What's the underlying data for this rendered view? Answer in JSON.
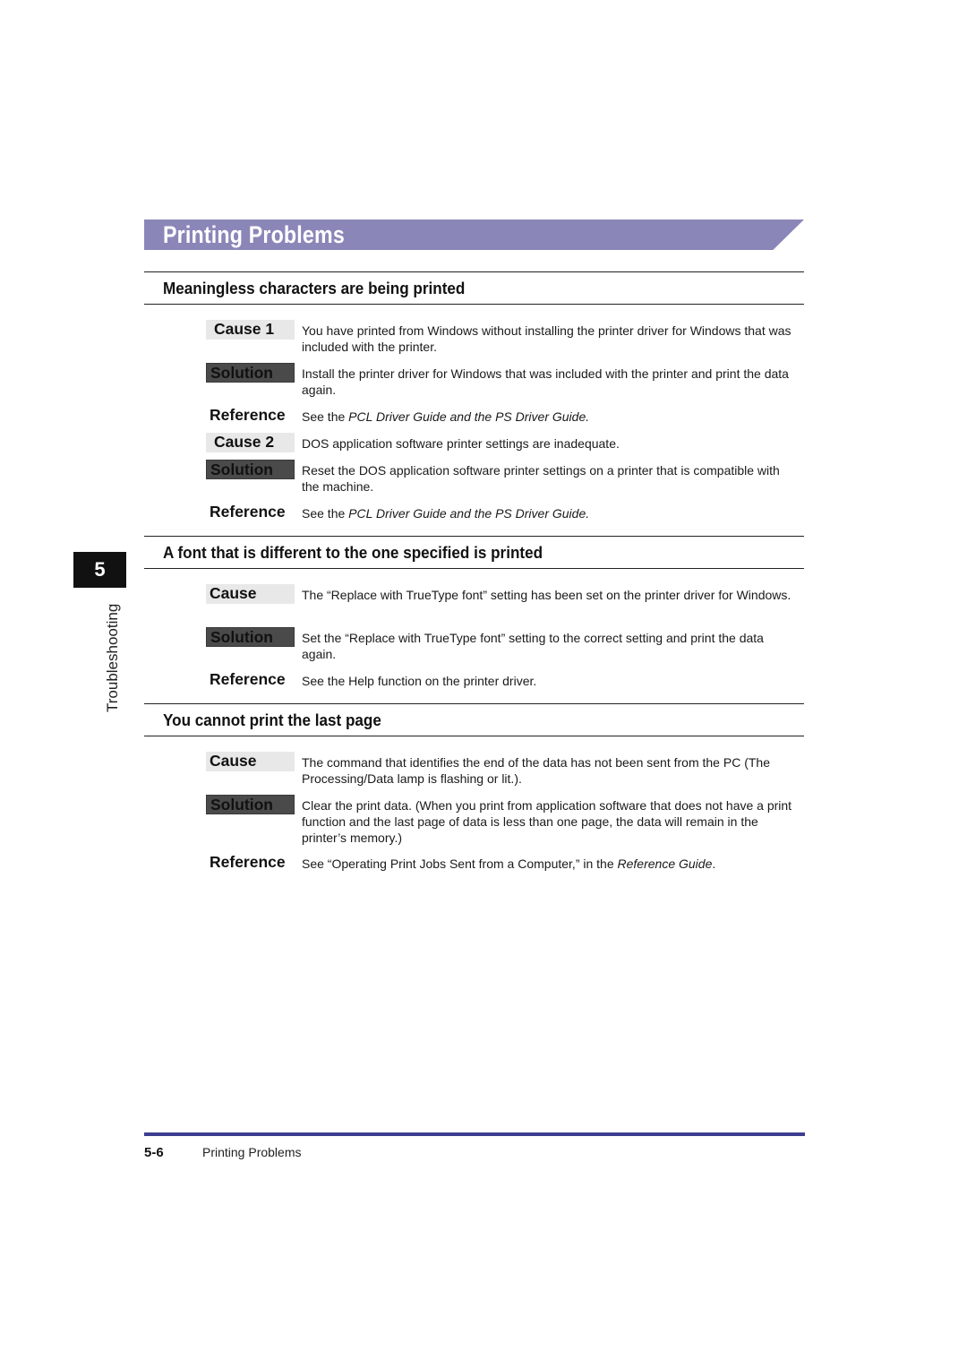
{
  "page_title": "Printing Problems",
  "side_tab": {
    "chapter_number": "5",
    "chapter_label": "Troubleshooting"
  },
  "sections": [
    {
      "heading": "Meaningless characters are being printed",
      "rows": [
        {
          "type": "cause",
          "label": "Cause 1",
          "text": "You have printed from Windows without installing the printer driver for Windows that was included with the printer."
        },
        {
          "type": "solution",
          "label": "Solution",
          "text": "Install the printer driver for Windows that was included with the printer and print  the data again."
        },
        {
          "type": "reference",
          "label": "Reference",
          "prefix": "See the ",
          "italic": "PCL Driver Guide and the PS Driver Guide.",
          "suffix": ""
        },
        {
          "type": "cause",
          "label": "Cause 2",
          "text": "DOS application software printer settings are inadequate."
        },
        {
          "type": "solution",
          "label": "Solution",
          "text": "Reset the DOS application software printer settings on a printer that is compatible with the machine."
        },
        {
          "type": "reference",
          "label": "Reference",
          "prefix": "See the ",
          "italic": "PCL Driver Guide and the PS Driver Guide.",
          "suffix": ""
        }
      ]
    },
    {
      "heading": "A font that is different to the one specified is printed",
      "rows": [
        {
          "type": "cause",
          "label": "Cause",
          "text": "The “Replace with TrueType font” setting has been set on the printer driver for Windows."
        },
        {
          "type": "solution",
          "label": "Solution",
          "text": "Set the “Replace with TrueType font” setting to the correct setting and print the data again."
        },
        {
          "type": "reference",
          "label": "Reference",
          "prefix": "See the Help function on the printer driver.",
          "italic": "",
          "suffix": ""
        }
      ]
    },
    {
      "heading": "You cannot print the last page",
      "rows": [
        {
          "type": "cause",
          "label": "Cause",
          "text": "The command that identifies the end of the data has not been sent from the PC (The Processing/Data lamp is flashing or lit.)."
        },
        {
          "type": "solution",
          "label": "Solution",
          "text": "Clear the print data. (When you print from application software that does not have a print function and the last page of data is less than one page, the data will remain in the printer’s memory.)"
        },
        {
          "type": "reference",
          "label": "Reference",
          "prefix": "See “Operating Print Jobs Sent from a Computer,” in the ",
          "italic": "Reference Guide",
          "suffix": "."
        }
      ]
    }
  ],
  "footer": {
    "page_number": "5-6",
    "section_title": "Printing Problems"
  },
  "colors": {
    "banner": "#8b86b8",
    "footer_rule": "#3d3d8f",
    "solution_label_bg": "#4a4a4a",
    "cause_label_bg": "#e8e8e8"
  }
}
